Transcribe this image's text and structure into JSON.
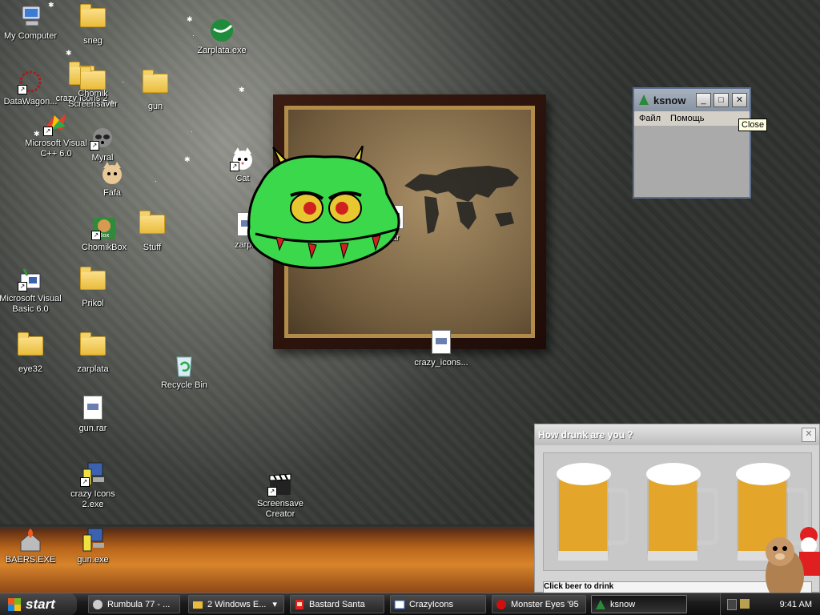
{
  "desktop": {
    "icons": [
      {
        "label": "My Computer"
      },
      {
        "label": "sneg"
      },
      {
        "label": "Zarplata.exe"
      },
      {
        "label": "DataWagon..."
      },
      {
        "label": "crazy Icons 2"
      },
      {
        "label": "gun"
      },
      {
        "label": "Chomik Screensaver"
      },
      {
        "label": "Microsoft Visual C++ 6.0"
      },
      {
        "label": "Myral"
      },
      {
        "label": "Fafa"
      },
      {
        "label": "Cat"
      },
      {
        "label": "zarpla"
      },
      {
        "label": "rar"
      },
      {
        "label": "ChomikBox"
      },
      {
        "label": "Stuff"
      },
      {
        "label": "Microsoft Visual Basic 6.0"
      },
      {
        "label": "Prikol"
      },
      {
        "label": "eye32"
      },
      {
        "label": "zarplata"
      },
      {
        "label": "Recycle Bin"
      },
      {
        "label": "crazy_icons..."
      },
      {
        "label": "gun.rar"
      },
      {
        "label": "crazy Icons 2.exe"
      },
      {
        "label": "Screensave Creator"
      },
      {
        "label": "BAERS.EXE"
      },
      {
        "label": "gun.exe"
      }
    ]
  },
  "ksnow": {
    "title": "ksnow",
    "menu": [
      "Файл",
      "Помощь"
    ],
    "tooltip": "Close",
    "min": "_",
    "max": "□",
    "close": "✕"
  },
  "drunk": {
    "title": "How drunk are you ?",
    "close": "✕",
    "bottom_text": "Click beer to drink"
  },
  "taskbar": {
    "start": "start",
    "tasks": [
      {
        "label": "Rumbula 77 - ..."
      },
      {
        "label": "2 Windows E..."
      },
      {
        "label": "Bastard Santa"
      },
      {
        "label": "CrazyIcons"
      },
      {
        "label": "Monster Eyes '95"
      },
      {
        "label": "ksnow"
      }
    ],
    "clock": "9:41 AM"
  },
  "colors": {
    "folder": "#e9bc3c",
    "monster": "#3ad84a",
    "taskbar": "#1c1c1c"
  }
}
